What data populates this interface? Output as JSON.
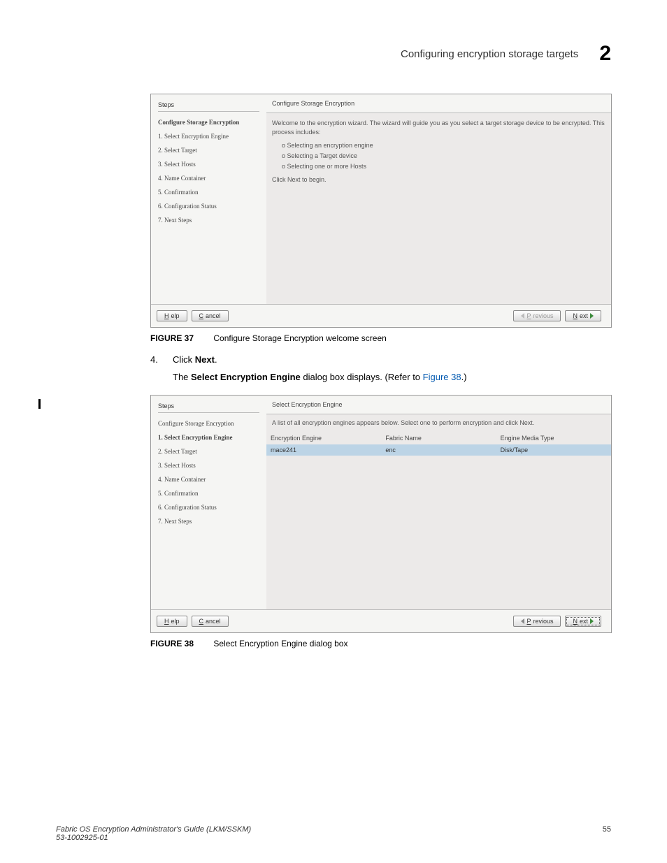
{
  "header": {
    "title": "Configuring encryption storage targets",
    "chapter": "2"
  },
  "fig37": {
    "steps_label": "Steps",
    "current": "Configure Storage Encryption",
    "steps": [
      "1. Select Encryption Engine",
      "2. Select Target",
      "3. Select Hosts",
      "4. Name Container",
      "5. Confirmation",
      "6. Configuration Status",
      "7. Next Steps"
    ],
    "main_title": "Configure Storage Encryption",
    "intro": "Welcome to the encryption wizard. The wizard will guide you as you select a target storage device to be encrypted. This process includes:",
    "bullets": [
      "o Selecting an encryption engine",
      "o Selecting a Target device",
      "o Selecting one or more Hosts"
    ],
    "click_next": "Click Next to begin.",
    "btn_help": "Help",
    "btn_cancel": "Cancel",
    "btn_prev": "Previous",
    "btn_next": "Next"
  },
  "caption37": {
    "num": "FIGURE 37",
    "text": "Configure Storage Encryption welcome screen"
  },
  "step4": {
    "num": "4.",
    "text_a": "Click ",
    "bold": "Next",
    "text_b": "."
  },
  "sub": {
    "a": "The ",
    "bold": "Select Encryption Engine",
    "b": " dialog box displays. (Refer to ",
    "link": "Figure 38",
    "c": ".)"
  },
  "fig38": {
    "steps_label": "Steps",
    "step0": "Configure Storage Encryption",
    "current": "1. Select Encryption Engine",
    "steps": [
      "2. Select Target",
      "3. Select Hosts",
      "4. Name Container",
      "5. Confirmation",
      "6. Configuration Status",
      "7. Next Steps"
    ],
    "main_title": "Select Encryption Engine",
    "intro": "A list of all encryption engines appears below. Select one to perform encryption and click Next.",
    "cols": {
      "c1": "Encryption Engine",
      "c2": "Fabric Name",
      "c3": "Engine Media Type"
    },
    "row": {
      "c1": "mace241",
      "c2": "enc",
      "c3": "Disk/Tape"
    },
    "btn_help": "Help",
    "btn_cancel": "Cancel",
    "btn_prev": "Previous",
    "btn_next": "Next"
  },
  "caption38": {
    "num": "FIGURE 38",
    "text": "Select Encryption Engine dialog box"
  },
  "footer": {
    "left1": "Fabric OS Encryption Administrator's Guide  (LKM/SSKM)",
    "left2": "53-1002925-01",
    "page": "55"
  }
}
